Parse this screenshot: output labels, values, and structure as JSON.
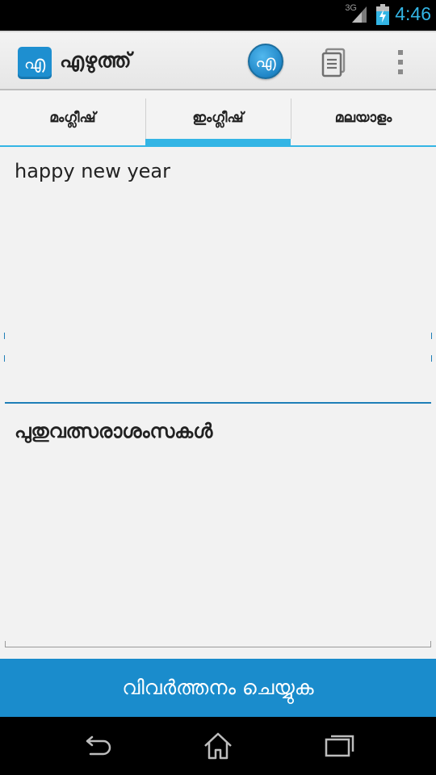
{
  "status_bar": {
    "network": "3G",
    "time": "4:46"
  },
  "action_bar": {
    "logo_glyph": "എ",
    "title": "എഴുത്ത്",
    "circle_glyph": "എ",
    "icons": {
      "copy": "copy-icon",
      "overflow": "overflow-menu-icon"
    }
  },
  "tabs": [
    {
      "label": "മംഗ്ലീഷ്"
    },
    {
      "label": "ഇംഗ്ലീഷ്",
      "selected": true
    },
    {
      "label": "മലയാളം"
    }
  ],
  "input": {
    "value": "happy new year"
  },
  "output": {
    "value": "പുതുവത്സരാശംസകൾ"
  },
  "translate_button": {
    "label": "വിവർത്തനം ചെയ്യുക"
  },
  "nav_bar": {
    "icons": [
      "back-icon",
      "home-icon",
      "recents-icon"
    ]
  },
  "colors": {
    "accent": "#33b5e5",
    "button": "#1a8ccc"
  }
}
